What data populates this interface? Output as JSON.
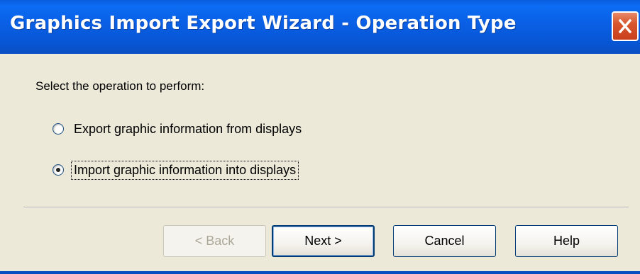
{
  "window": {
    "title": "Graphics Import Export Wizard - Operation Type"
  },
  "content": {
    "prompt": "Select the operation to perform:",
    "options": [
      {
        "label": "Export graphic information from displays",
        "selected": false
      },
      {
        "label": "Import graphic information into displays",
        "selected": true
      }
    ]
  },
  "buttons": {
    "back": "< Back",
    "next": "Next >",
    "cancel": "Cancel",
    "help": "Help"
  },
  "colors": {
    "titlebar": "#0a5fe4",
    "close_button": "#d8572e",
    "dialog_background": "#ece9d8"
  },
  "icons": {
    "close": "close-icon"
  }
}
